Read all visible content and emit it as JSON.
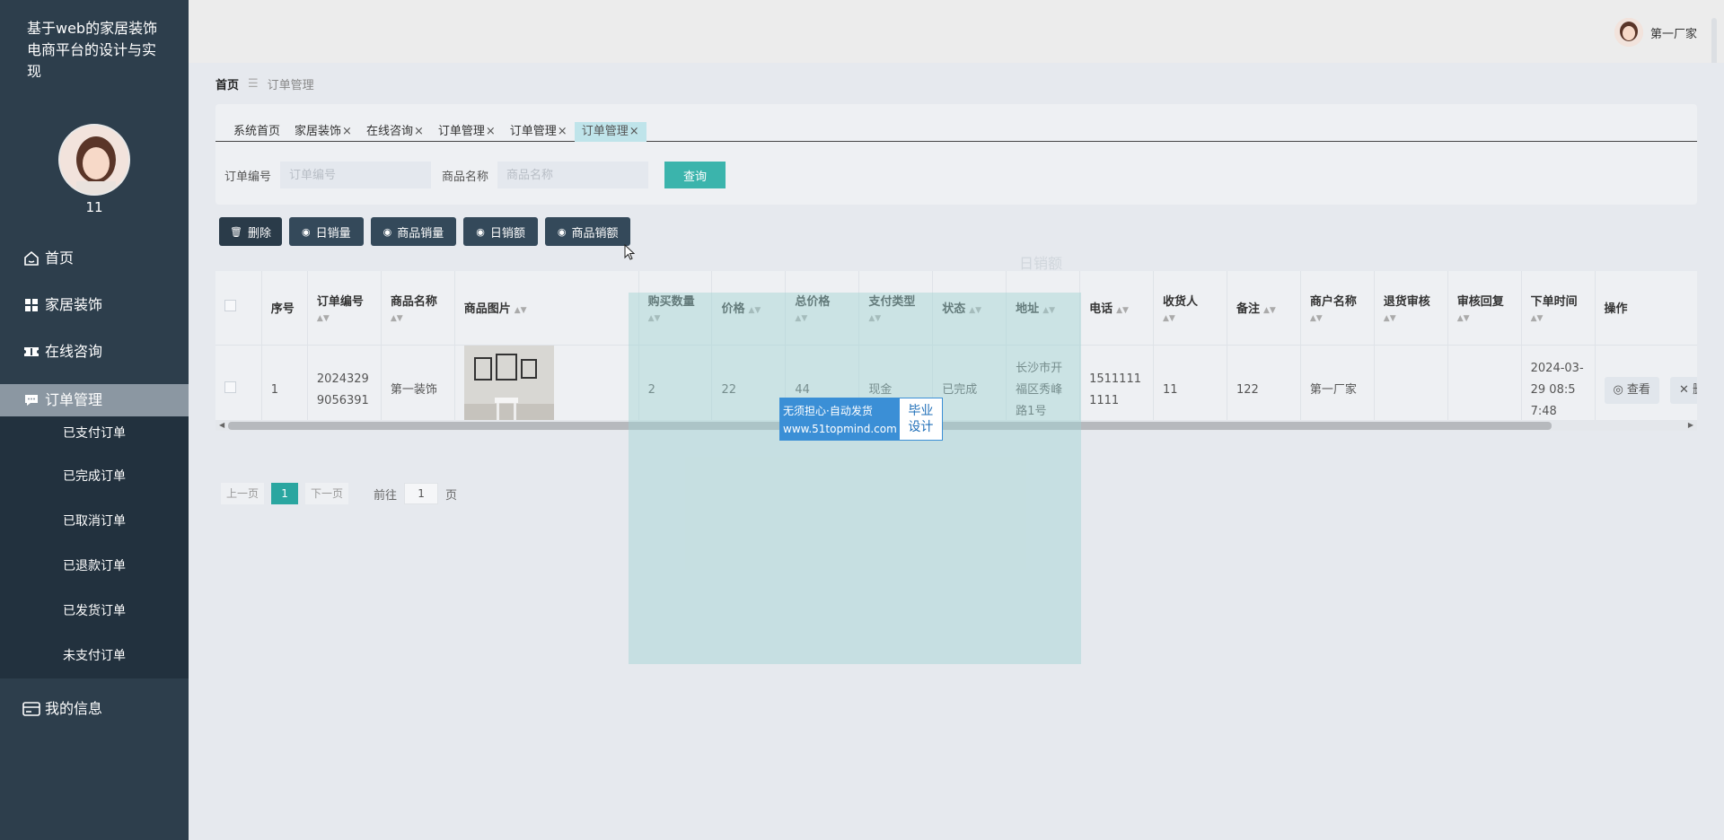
{
  "app": {
    "title": "基于web的家居装饰电商平台的设计与实现",
    "user_name": "11",
    "top_user": "第一厂家"
  },
  "sidebar": {
    "items": [
      {
        "label": "首页",
        "icon": "home-icon"
      },
      {
        "label": "家居装饰",
        "icon": "grid-icon"
      },
      {
        "label": "在线咨询",
        "icon": "ticket-icon"
      },
      {
        "label": "订单管理",
        "icon": "chat-icon"
      }
    ],
    "sub_items": [
      "已支付订单",
      "已完成订单",
      "已取消订单",
      "已退款订单",
      "已发货订单",
      "未支付订单"
    ],
    "bottom_item": {
      "label": "我的信息",
      "icon": "card-icon"
    }
  },
  "breadcrumb": {
    "home": "首页",
    "current": "订单管理"
  },
  "tabs": [
    {
      "label": "系统首页",
      "closable": false
    },
    {
      "label": "家居装饰",
      "closable": true
    },
    {
      "label": "在线咨询",
      "closable": true
    },
    {
      "label": "订单管理",
      "closable": true
    },
    {
      "label": "订单管理",
      "closable": true
    },
    {
      "label": "订单管理",
      "closable": true
    }
  ],
  "search": {
    "order_no_label": "订单编号",
    "order_no_placeholder": "订单编号",
    "product_name_label": "商品名称",
    "product_name_placeholder": "商品名称",
    "query_button": "查询"
  },
  "actions": {
    "delete": "删除",
    "daily_volume": "日销量",
    "product_volume": "商品销量",
    "daily_amount": "日销额",
    "product_amount": "商品销额"
  },
  "table": {
    "headers": [
      "序号",
      "订单编号",
      "商品名称",
      "商品图片",
      "购买数量",
      "价格",
      "总价格",
      "支付类型",
      "状态",
      "地址",
      "电话",
      "收货人",
      "备注",
      "商户名称",
      "退货审核",
      "审核回复",
      "下单时间",
      "操作"
    ],
    "rows": [
      {
        "index": "1",
        "order_no": "20243299056391",
        "product_name": "第一装饰",
        "quantity": "2",
        "price": "22",
        "total": "44",
        "pay_type": "现金",
        "status": "已完成",
        "address": "长沙市开福区秀峰路1号",
        "phone": "15111111111",
        "receiver": "11",
        "remark": "122",
        "merchant": "第一厂家",
        "return_review": "",
        "review_reply": "",
        "order_time": "2024-03-29 08:57:48"
      }
    ],
    "op_view": "查看",
    "op_delete": "删除"
  },
  "pager": {
    "prev": "上一页",
    "current": "1",
    "next": "下一页",
    "goto_label": "前往",
    "goto_value": "1",
    "page_unit": "页"
  },
  "watermark": {
    "line1": "无须担心·自动发货",
    "line2": "www.51topmind.com",
    "right1": "毕业",
    "right2": "设计"
  },
  "ghost": {
    "chart_title": "日销额"
  },
  "colors": {
    "sidebar_bg": "#2d3e4c",
    "accent": "#3bb4ac",
    "button_dark": "#34495a"
  }
}
